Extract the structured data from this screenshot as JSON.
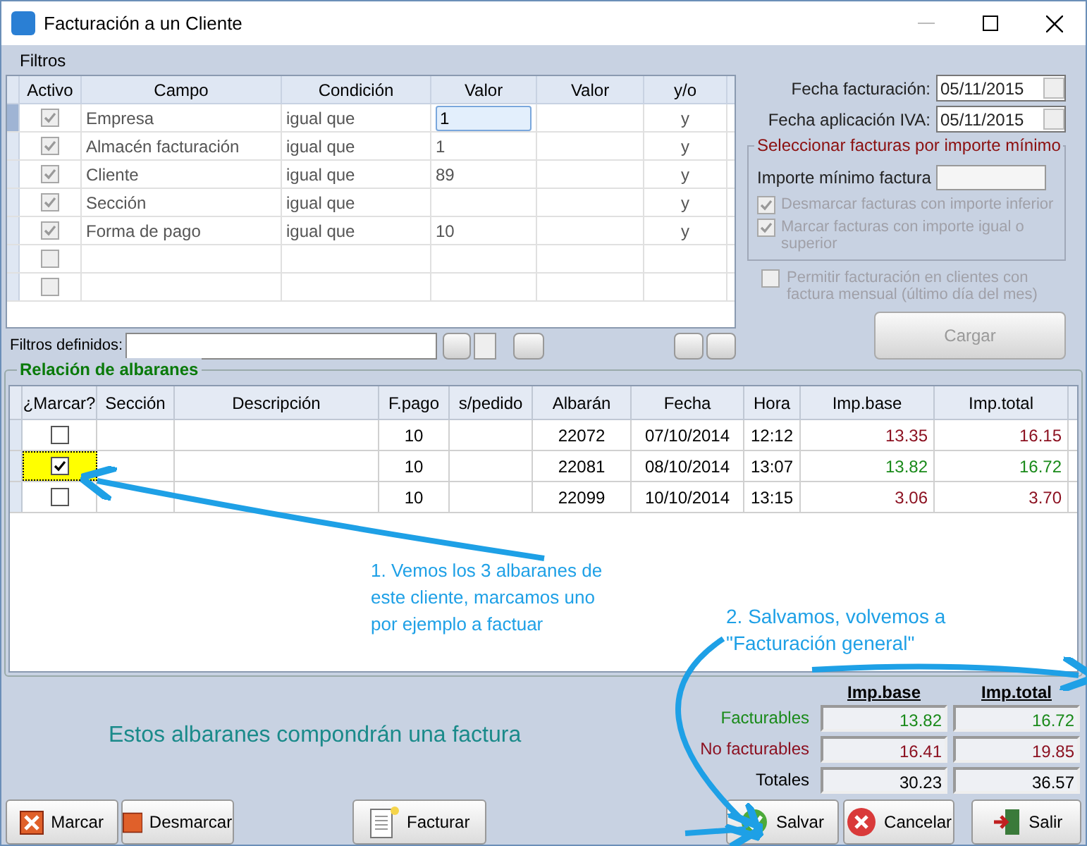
{
  "window": {
    "title": "Facturación a un Cliente"
  },
  "filters": {
    "title": "Filtros",
    "columns": [
      "Activo",
      "Campo",
      "Condición",
      "Valor",
      "Valor",
      "y/o"
    ],
    "rows": [
      {
        "checked": true,
        "campo": "Empresa",
        "condicion": "igual que",
        "valor": "1",
        "yo": "y",
        "selected": true
      },
      {
        "checked": true,
        "campo": "Almacén facturación",
        "condicion": "igual que",
        "valor": "1",
        "yo": "y",
        "selected": false
      },
      {
        "checked": true,
        "campo": "Cliente",
        "condicion": "igual que",
        "valor": "89",
        "yo": "y",
        "selected": false
      },
      {
        "checked": true,
        "campo": "Sección",
        "condicion": "igual que",
        "yo": "y",
        "selected": false
      },
      {
        "checked": true,
        "campo": "Forma de pago",
        "condicion": "igual que",
        "valor": "10",
        "yo": "y",
        "selected": false
      },
      {
        "checked": false,
        "selected": false
      },
      {
        "checked": false,
        "selected": false
      }
    ],
    "defined_label": "Filtros definidos:"
  },
  "options": {
    "fecha_facturacion": {
      "label": "Fecha facturación:",
      "value": "05/11/2015"
    },
    "fecha_iva": {
      "label": "Fecha aplicación IVA:",
      "value": "05/11/2015"
    },
    "group_title": "Seleccionar facturas por importe mínimo",
    "importe_label": "Importe mínimo factura",
    "group_checks": [
      {
        "label": "Desmarcar facturas con importe inferior",
        "checked": true,
        "disabled": true
      },
      {
        "label": "Marcar facturas con importe igual o superior",
        "checked": true,
        "disabled": true
      }
    ],
    "permitir": {
      "label": "Permitir facturación en clientes con factura mensual (último día del mes)",
      "checked": false,
      "disabled": true
    },
    "cargar": {
      "label": "Cargar",
      "disabled": true
    }
  },
  "albaranes": {
    "title": "Relación de albaranes",
    "columns": [
      "¿Marcar?",
      "Sección",
      "Descripción",
      "F.pago",
      "s/pedido",
      "Albarán",
      "Fecha",
      "Hora",
      "Imp.base",
      "Imp.total"
    ],
    "rows": [
      {
        "checked": false,
        "selected": false,
        "facturable": false,
        "fpago": "10",
        "albaran": "22072",
        "fecha": "07/10/2014",
        "hora": "12:12",
        "base": "13.35",
        "total": "16.15"
      },
      {
        "checked": true,
        "selected": true,
        "facturable": true,
        "fpago": "10",
        "albaran": "22081",
        "fecha": "08/10/2014",
        "hora": "13:07",
        "base": "13.82",
        "total": "16.72"
      },
      {
        "checked": false,
        "selected": false,
        "facturable": false,
        "fpago": "10",
        "albaran": "22099",
        "fecha": "10/10/2014",
        "hora": "13:15",
        "base": "3.06",
        "total": "3.70"
      }
    ]
  },
  "summary": {
    "message": "Estos albaranes compondrán una factura",
    "headers": [
      "Imp.base",
      "Imp.total"
    ],
    "rows": [
      {
        "kind": "facturable",
        "label": "Facturables",
        "base": "13.82",
        "total": "16.72"
      },
      {
        "kind": "no_facturable",
        "label": "No facturables",
        "base": "16.41",
        "total": "19.85"
      },
      {
        "kind": "total",
        "label": "Totales",
        "base": "30.23",
        "total": "36.57"
      }
    ]
  },
  "buttons": [
    {
      "kind": "marcar",
      "label": "Marcar"
    },
    {
      "kind": "desmarcar",
      "label": "Desmarcar"
    },
    {
      "kind": "facturar",
      "label": "Facturar"
    },
    {
      "kind": "salvar",
      "label": "Salvar"
    },
    {
      "kind": "cancelar",
      "label": "Cancelar"
    },
    {
      "kind": "salir",
      "label": "Salir"
    }
  ],
  "annotations": [
    {
      "text": "1. Vemos los 3 albaranes de este cliente, marcamos uno por ejemplo a factuar"
    },
    {
      "text": "2. Salvamos, volvemos a \"Facturación general\""
    }
  ]
}
